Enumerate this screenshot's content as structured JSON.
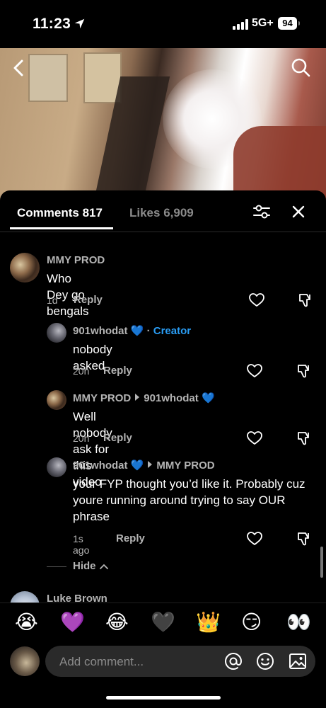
{
  "status_bar": {
    "time": "11:23",
    "network": "5G+",
    "battery": "94"
  },
  "tabs": {
    "comments": "Comments 817",
    "likes": "Likes 6,909"
  },
  "comments": [
    {
      "user": "MMY PROD",
      "text": "Who Dey go bengals",
      "time": "1d",
      "reply_label": "Reply"
    },
    {
      "user": "901whodat",
      "badge": "Creator",
      "separator": "·",
      "text": "nobody asked",
      "time": "20h",
      "reply_label": "Reply"
    },
    {
      "user": "MMY PROD",
      "reply_to": "901whodat",
      "text": "Well nobody ask for this video",
      "time": "20h",
      "reply_label": "Reply"
    },
    {
      "user": "901whodat",
      "reply_to": "MMY PROD",
      "text": "your FYP thought you’d like it. Probably cuz youre running around trying to say OUR phrase",
      "time": "1s ago",
      "reply_label": "Reply"
    }
  ],
  "heart_emoji": "💙",
  "hide_label": "Hide",
  "next_comment": {
    "user": "Luke Brown"
  },
  "emoji_bar": [
    "😭",
    "💜",
    "😂",
    "🖤",
    "👑",
    "😏",
    "👀"
  ],
  "input": {
    "placeholder": "Add comment..."
  },
  "colors": {
    "background": "#000000",
    "creator": "#2a9df4",
    "muted": "#b4b4b4",
    "input_bg": "#2a2a2a"
  }
}
